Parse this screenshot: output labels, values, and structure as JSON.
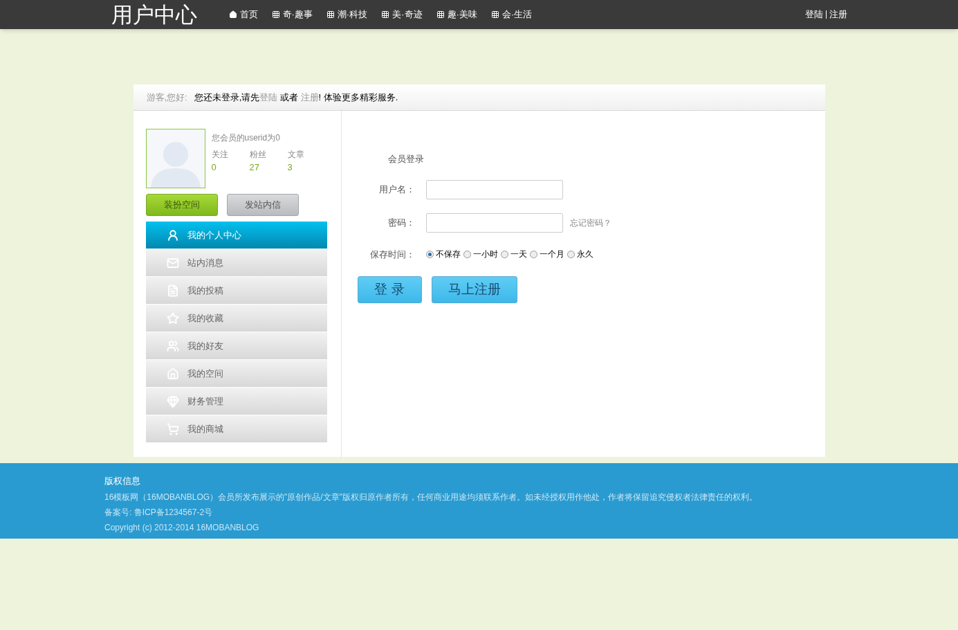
{
  "header": {
    "logo": "用户中心",
    "nav": [
      {
        "label": "首页"
      },
      {
        "label": "奇·趣事"
      },
      {
        "label": "潮·科技"
      },
      {
        "label": "美·奇迹"
      },
      {
        "label": "趣·美味"
      },
      {
        "label": "会·生活"
      }
    ],
    "auth_links": [
      "登陆",
      "注册"
    ]
  },
  "notice": {
    "greeting": "游客,您好:",
    "parts": [
      {
        "kind": "text",
        "text": "您还未登录,请先"
      },
      {
        "kind": "link",
        "text": "登陆"
      },
      {
        "kind": "text",
        "text": " 或者 "
      },
      {
        "kind": "link",
        "text": "注册"
      },
      {
        "kind": "text",
        "text": "! 体验更多精彩服务."
      }
    ]
  },
  "profile": {
    "userid_text": "您会员的userid为0",
    "stats": [
      {
        "label": "关注",
        "value": "0"
      },
      {
        "label": "粉丝",
        "value": "27"
      },
      {
        "label": "文章",
        "value": "3"
      }
    ],
    "buttons": [
      {
        "label": "装扮空间",
        "kind": "green"
      },
      {
        "label": "发站内信",
        "kind": "gray"
      }
    ]
  },
  "menu": [
    {
      "label": "我的个人中心",
      "selected": true
    },
    {
      "label": "站内消息",
      "selected": false
    },
    {
      "label": "我的投稿",
      "selected": false
    },
    {
      "label": "我的收藏",
      "selected": false
    },
    {
      "label": "我的好友",
      "selected": false
    },
    {
      "label": "我的空间",
      "selected": false
    },
    {
      "label": "财务管理",
      "selected": false
    },
    {
      "label": "我的商城",
      "selected": false
    }
  ],
  "login": {
    "title": "会员登录",
    "fields": [
      {
        "label": "用户名：",
        "kind": "text"
      },
      {
        "label": "密码：",
        "kind": "password"
      }
    ],
    "forgot_link": "忘记密码？",
    "save_time": {
      "label": "保存时间：",
      "options": [
        {
          "label": "不保存",
          "selected": true
        },
        {
          "label": "一小时",
          "selected": false
        },
        {
          "label": "一天",
          "selected": false
        },
        {
          "label": "一个月",
          "selected": false
        },
        {
          "label": "永久",
          "selected": false
        }
      ]
    },
    "buttons": [
      "登 录",
      "马上注册"
    ]
  },
  "footer": {
    "title": "版权信息",
    "lines": [
      "16模板网（16MOBANBLOG）会员所发布展示的\"原创作品/文章\"版权归原作者所有，任何商业用途均须联系作者。如未经授权用作他处，作者将保留追究侵权者法律责任的权利。",
      "备案号: 鲁ICP备1234567-2号",
      "Copyright (c) 2012-2014 16MOBANBLOG"
    ]
  }
}
